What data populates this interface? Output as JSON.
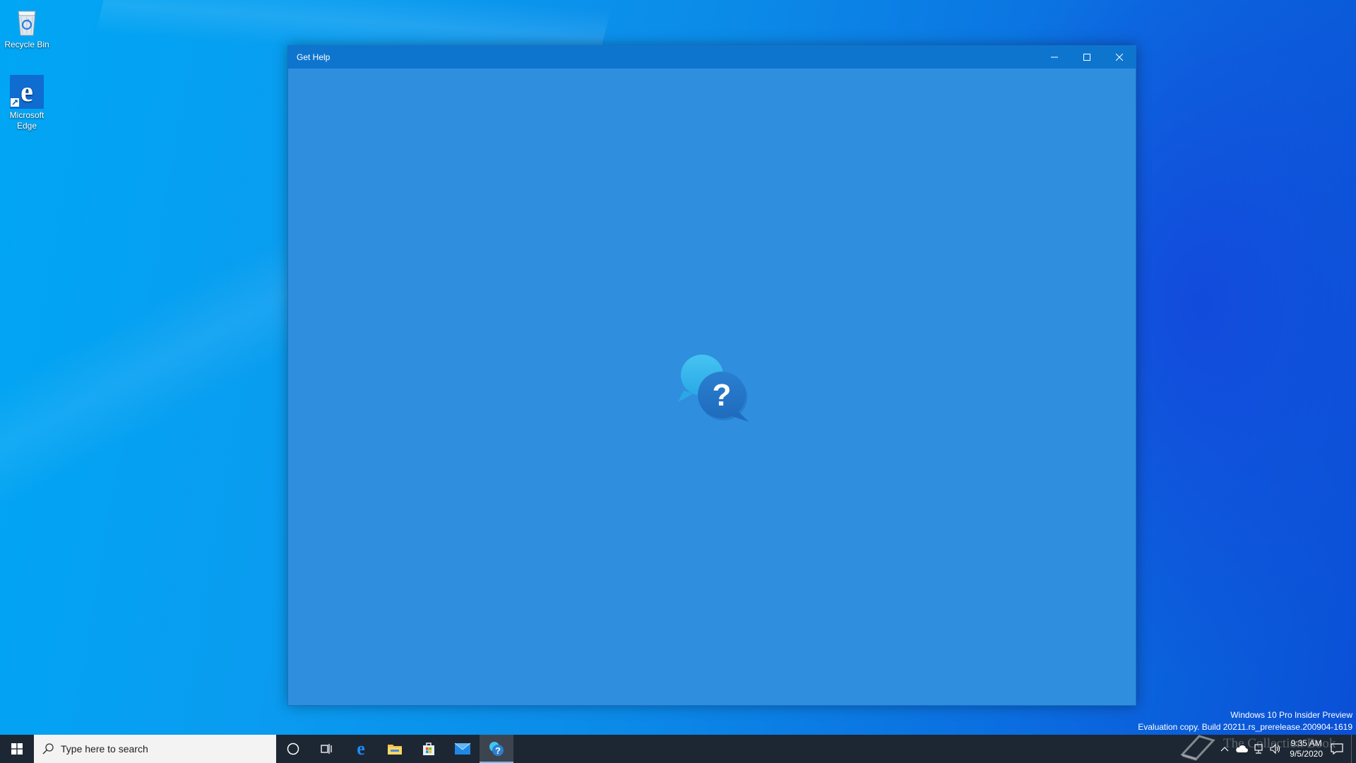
{
  "desktop": {
    "icons": [
      {
        "label": "Recycle Bin",
        "icon": "recycle-bin-icon"
      },
      {
        "label": "Microsoft Edge",
        "icon": "edge-icon"
      }
    ]
  },
  "window": {
    "title": "Get Help",
    "controls": {
      "minimize": "minimize-icon",
      "maximize": "maximize-icon",
      "close": "close-icon"
    },
    "splash_icon": "get-help-question-icon",
    "background": "#2f8fde",
    "titlebar_color": "#0e75cf"
  },
  "watermark": {
    "line1": "Windows 10 Pro Insider Preview",
    "line2": "Evaluation copy. Build 20211.rs_prerelease.200904-1619"
  },
  "taskbar": {
    "search_placeholder": "Type here to search",
    "pinned": [
      {
        "name": "cortana",
        "icon": "cortana-circle-icon"
      },
      {
        "name": "task-view",
        "icon": "task-view-icon"
      },
      {
        "name": "edge",
        "icon": "edge-icon"
      },
      {
        "name": "file-explorer",
        "icon": "folder-icon"
      },
      {
        "name": "store",
        "icon": "store-icon"
      },
      {
        "name": "mail",
        "icon": "mail-icon"
      },
      {
        "name": "get-help",
        "icon": "get-help-icon",
        "active": true
      }
    ],
    "clock": {
      "time": "9:35 AM",
      "date": "9/5/2020"
    },
    "brand_text": "The Collection Book"
  }
}
